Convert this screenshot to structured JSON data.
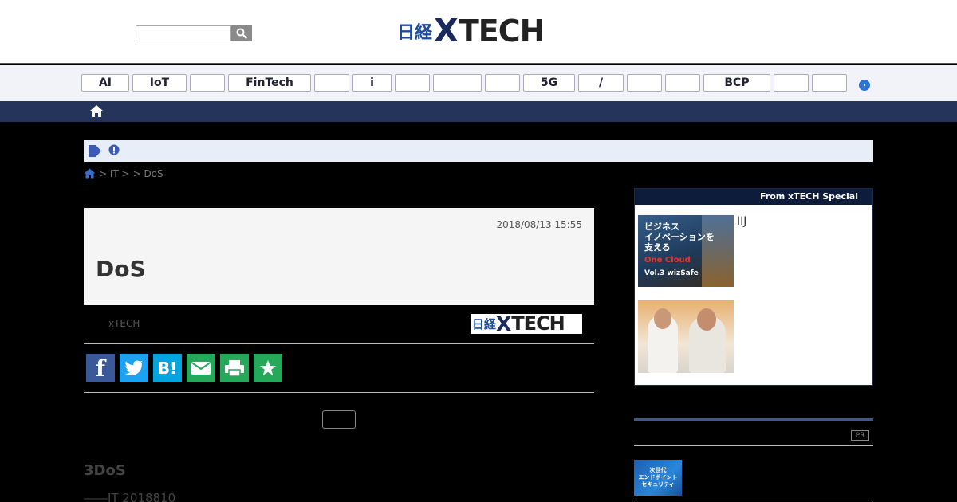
{
  "header": {
    "search_placeholder": "",
    "logo_prefix": "日経",
    "logo_x": "X",
    "logo_suffix": "TECH"
  },
  "tags": [
    "AI",
    "IoT",
    "",
    "FinTech",
    "",
    "i",
    "",
    "",
    "",
    "5G",
    "/",
    "",
    "",
    "BCP",
    "",
    ""
  ],
  "breadcrumb": {
    "item1": "> IT >",
    "item2": "> DoS"
  },
  "article": {
    "date": "2018/08/13 15:55",
    "title": "DoS",
    "author": "xTECH",
    "source_logo_prefix": "日経",
    "source_logo_x": "X",
    "source_logo_suffix": "TECH",
    "section_heading": "3DoS",
    "body_first_line": "――IT 2018810"
  },
  "share_buttons": [
    "facebook",
    "twitter",
    "hatena",
    "mail",
    "print",
    "clip"
  ],
  "sidebar": {
    "special_heading": "From  xTECH Special",
    "special_caption_1": "IIJ",
    "special_img1_lines": [
      "ビジネス",
      "イノベーションを",
      "支える",
      "One Cloud",
      "Vol.3  wizSafe"
    ],
    "pr_badge": "PR",
    "pr_img_lines": [
      "次世代",
      "エンドポイント",
      "セキュリティ"
    ]
  },
  "colors": {
    "navy": "#24345a",
    "logo_blue": "#1a4a9c",
    "tag_bg": "#f1f3f8",
    "notice_bg": "#e8eef8",
    "facebook": "#3b5998",
    "twitter": "#1da1f2",
    "hatena": "#00a4de",
    "mail": "#25a85a",
    "print": "#25a85a",
    "clip": "#25a85a"
  }
}
